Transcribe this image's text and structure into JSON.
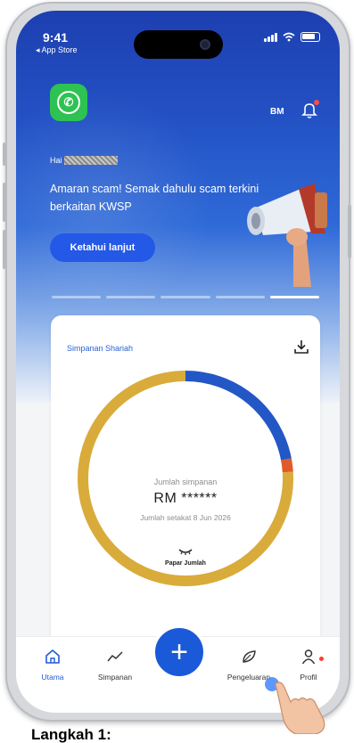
{
  "status_bar": {
    "time": "9:41",
    "back_label": "◂ App Store"
  },
  "header": {
    "user_initials": "BM",
    "greeting_prefix": "Hai"
  },
  "banner": {
    "message": "Amaran scam! Semak dahulu scam terkini berkaitan KWSP",
    "button_label": "Ketahui lanjut",
    "pagination_count": 5,
    "active_index": 4
  },
  "savings_card": {
    "label": "Simpanan Shariah",
    "total_label": "Jumlah simpanan",
    "amount": "RM ******",
    "as_of": "Jumlah setakat 8 Jun 2026",
    "show_label": "Papar Jumlah"
  },
  "donut_segments": [
    {
      "name": "blue",
      "color": "#2357c6",
      "fraction": 0.22
    },
    {
      "name": "red",
      "color": "#e05a2a",
      "fraction": 0.02
    },
    {
      "name": "gold",
      "color": "#d9ab3b",
      "fraction": 0.76
    }
  ],
  "bottom_nav": {
    "items": [
      {
        "label": "Utama",
        "icon": "home-icon",
        "active": true
      },
      {
        "label": "Simpanan",
        "icon": "trend-icon",
        "active": false
      },
      {
        "label": "Pengeluaran",
        "icon": "leaf-icon",
        "active": false
      },
      {
        "label": "Profil",
        "icon": "person-icon",
        "active": false
      }
    ],
    "fab_symbol": "+"
  },
  "footer": {
    "caption": "Langkah 1:"
  },
  "colors": {
    "primary": "#1a5ad8",
    "accent": "#2458e6",
    "whatsapp": "#2ec252"
  }
}
